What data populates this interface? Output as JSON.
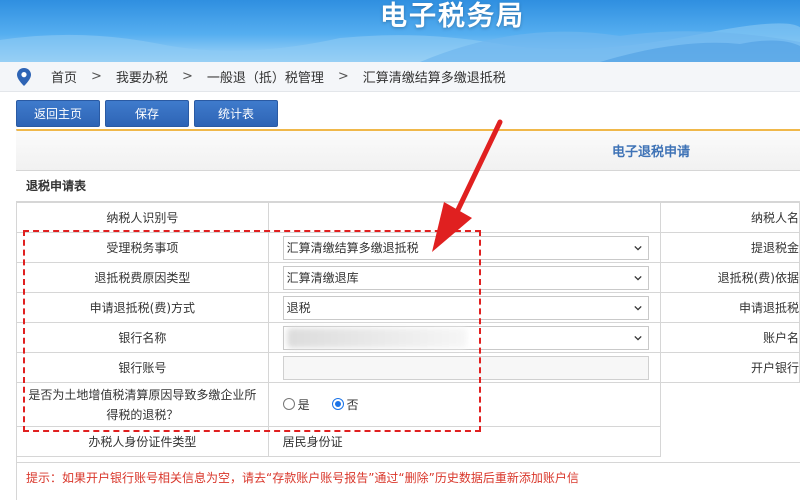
{
  "header": {
    "title": "电子税务局"
  },
  "breadcrumb": [
    "首页",
    "我要办税",
    "一般退（抵）税管理",
    "汇算清缴结算多缴退抵税"
  ],
  "toolbar": {
    "home": "返回主页",
    "save": "保存",
    "stats": "统计表"
  },
  "form": {
    "title": "电子退税申请",
    "section": "退税申请表",
    "rows": {
      "taxpayer_id": {
        "label": "纳税人识别号",
        "right": "纳税人名"
      },
      "matter": {
        "label": "受理税务事项",
        "value": "汇算清缴结算多缴退抵税",
        "right": "提退税金"
      },
      "reason": {
        "label": "退抵税费原因类型",
        "value": "汇算清缴退库",
        "right": "退抵税(费)依据"
      },
      "method": {
        "label": "申请退抵税(费)方式",
        "value": "退税",
        "right": "申请退抵税"
      },
      "bank": {
        "label": "银行名称",
        "right": "账户名"
      },
      "account": {
        "label": "银行账号",
        "right": "开户银行"
      },
      "land": {
        "label": "是否为土地增值税清算原因导致多缴企业所得税的退税？",
        "option_yes": "是",
        "option_no": "否",
        "selected": "否"
      },
      "id_type": {
        "label": "办税人身份证件类型",
        "value": "居民身份证"
      }
    },
    "tip": "提示：如果开户银行账号相关信息为空，请去“存款账户账号报告”通过“删除”历史数据后重新添加账户信"
  },
  "colors": {
    "accent": "#2e64b5",
    "warning": "#d9372b",
    "highlight": "#e02020",
    "banner": "#3d9be6"
  },
  "icons": [
    "location-pin-icon",
    "chevron-down-icon",
    "arrow-pointer-icon"
  ]
}
